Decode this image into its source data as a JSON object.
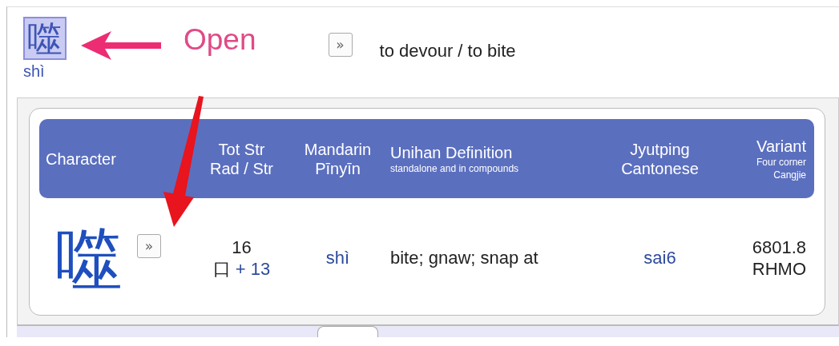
{
  "entry": {
    "character": "噬",
    "pinyin": "shì",
    "annotation": "Open",
    "expand_button": "»",
    "definition": "to devour / to bite"
  },
  "table": {
    "columns": [
      {
        "lines": [
          {
            "text": "Character",
            "kind": "main"
          }
        ]
      },
      {
        "lines": [
          {
            "text": "Tot Str",
            "kind": "main"
          },
          {
            "text": "Rad / Str",
            "kind": "main"
          }
        ]
      },
      {
        "lines": [
          {
            "text": "Mandarin",
            "kind": "main"
          },
          {
            "text": "Pīnyīn",
            "kind": "main"
          }
        ]
      },
      {
        "lines": [
          {
            "text": "Unihan Definition",
            "kind": "main"
          },
          {
            "text": "standalone and in compounds",
            "kind": "sub"
          }
        ]
      },
      {
        "lines": [
          {
            "text": "Jyutping",
            "kind": "main"
          },
          {
            "text": "Cantonese",
            "kind": "main"
          }
        ]
      },
      {
        "lines": [
          {
            "text": "Variant",
            "kind": "main"
          },
          {
            "text": "Four corner",
            "kind": "sub"
          },
          {
            "text": "Cangjie",
            "kind": "sub"
          }
        ]
      }
    ],
    "rows": [
      {
        "character": "噬",
        "expand_button": "»",
        "total_strokes": "16",
        "radical": "口",
        "radical_strokes": "+ 13",
        "pinyin": "shì",
        "definition": "bite; gnaw; snap at",
        "jyutping": "sai6",
        "four_corner": "6801.8",
        "cangjie": "RHMO"
      }
    ]
  }
}
